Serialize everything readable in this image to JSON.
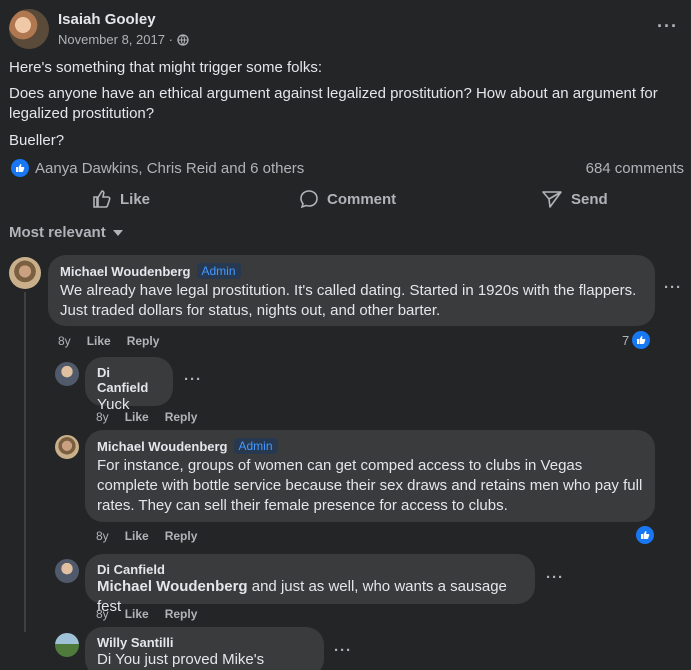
{
  "post": {
    "author": "Isaiah Gooley",
    "date": "November 8, 2017 ·",
    "more": "···",
    "line1": "Here's something that might trigger some folks:",
    "line2": "Does anyone have an ethical argument against legalized prostitution? How about an argument for legalized prostitution?",
    "line3": "Bueller?",
    "reactions": "Aanya Dawkins, Chris Reid and 6 others",
    "comments_count": "684 comments"
  },
  "actions": {
    "like": "Like",
    "comment": "Comment",
    "send": "Send"
  },
  "sort": {
    "label": "Most relevant"
  },
  "comments": [
    {
      "name": "Michael Woudenberg",
      "badge": "Admin",
      "text": "We already have legal prostitution. It's called dating. Started in 1920s with the flappers. Just traded dollars for status, nights out, and other barter.",
      "age": "8y",
      "like": "Like",
      "reply": "Reply",
      "reactions": "7"
    },
    {
      "name": "Di Canfield",
      "text": "Yuck",
      "age": "8y",
      "like": "Like",
      "reply": "Reply"
    },
    {
      "name": "Michael Woudenberg",
      "badge": "Admin",
      "text": "For instance, groups of women can get comped access to clubs in Vegas complete with bottle service because their sex draws and retains men who pay full rates. They can sell their female presence for access to clubs.",
      "age": "8y",
      "like": "Like",
      "reply": "Reply"
    },
    {
      "name": "Di Canfield",
      "tag": "Michael Woudenberg",
      "text": " and just as well, who wants a sausage fest",
      "age": "8y",
      "like": "Like",
      "reply": "Reply"
    },
    {
      "name": "Willy Santilli",
      "tag": "Di",
      "text": " You just proved Mike's point..."
    }
  ],
  "more_label": "···",
  "colors": {
    "accent": "#1877f2",
    "admin": "#4599ff",
    "bubble": "#3a3b3c",
    "background": "#242526"
  }
}
